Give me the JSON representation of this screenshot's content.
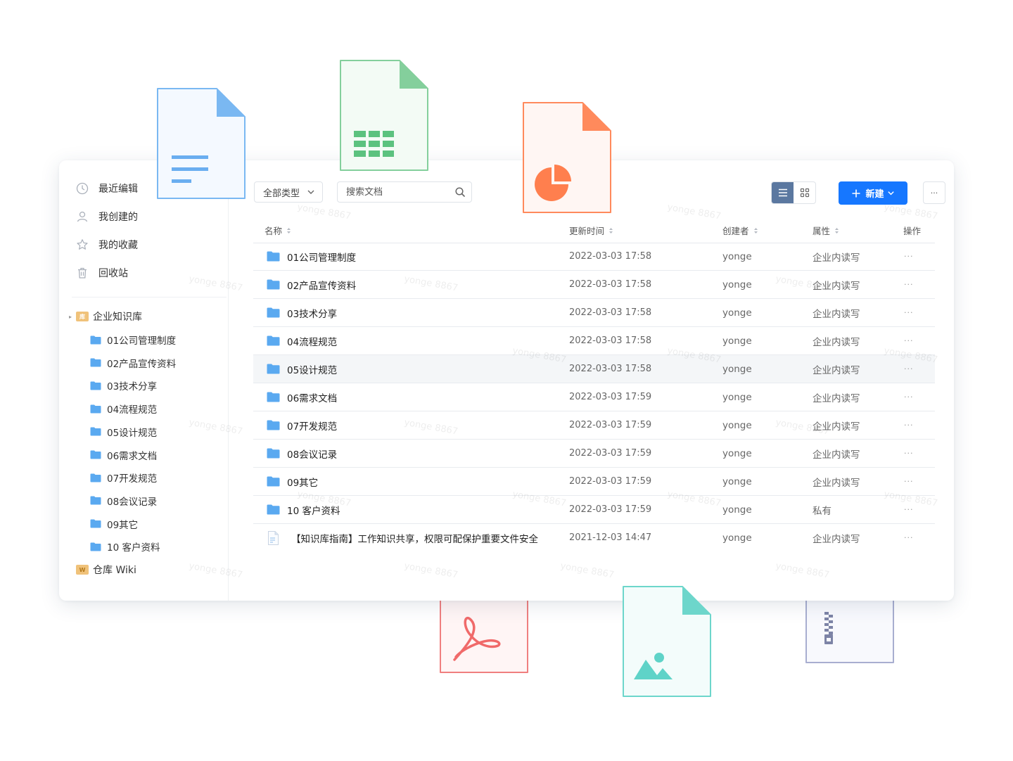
{
  "sidebar": {
    "nav": [
      {
        "label": "最近编辑",
        "icon": "clock-icon"
      },
      {
        "label": "我创建的",
        "icon": "user-icon"
      },
      {
        "label": "我的收藏",
        "icon": "star-icon"
      },
      {
        "label": "回收站",
        "icon": "trash-icon"
      }
    ],
    "tree_root": {
      "label": "企业知识库",
      "badge": "库"
    },
    "tree_children": [
      "01公司管理制度",
      "02产品宣传资料",
      "03技术分享",
      "04流程规范",
      "05设计规范",
      "06需求文档",
      "07开发规范",
      "08会议记录",
      "09其它",
      "10 客户资料"
    ],
    "wiki": {
      "label": "仓库 Wiki",
      "badge": "W"
    }
  },
  "toolbar": {
    "type_filter": "全部类型",
    "search_placeholder": "搜索文档",
    "new_label": "新建",
    "more_label": "···"
  },
  "table": {
    "headers": {
      "name": "名称",
      "time": "更新时间",
      "creator": "创建者",
      "attr": "属性",
      "op": "操作"
    },
    "rows": [
      {
        "name": "01公司管理制度",
        "time": "2022-03-03 17:58",
        "creator": "yonge",
        "attr": "企业内读写",
        "type": "folder"
      },
      {
        "name": "02产品宣传资料",
        "time": "2022-03-03 17:58",
        "creator": "yonge",
        "attr": "企业内读写",
        "type": "folder"
      },
      {
        "name": "03技术分享",
        "time": "2022-03-03 17:58",
        "creator": "yonge",
        "attr": "企业内读写",
        "type": "folder"
      },
      {
        "name": "04流程规范",
        "time": "2022-03-03 17:58",
        "creator": "yonge",
        "attr": "企业内读写",
        "type": "folder"
      },
      {
        "name": "05设计规范",
        "time": "2022-03-03 17:58",
        "creator": "yonge",
        "attr": "企业内读写",
        "type": "folder"
      },
      {
        "name": "06需求文档",
        "time": "2022-03-03 17:59",
        "creator": "yonge",
        "attr": "企业内读写",
        "type": "folder"
      },
      {
        "name": "07开发规范",
        "time": "2022-03-03 17:59",
        "creator": "yonge",
        "attr": "企业内读写",
        "type": "folder"
      },
      {
        "name": "08会议记录",
        "time": "2022-03-03 17:59",
        "creator": "yonge",
        "attr": "企业内读写",
        "type": "folder"
      },
      {
        "name": "09其它",
        "time": "2022-03-03 17:59",
        "creator": "yonge",
        "attr": "企业内读写",
        "type": "folder"
      },
      {
        "name": "10 客户资料",
        "time": "2022-03-03 17:59",
        "creator": "yonge",
        "attr": "私有",
        "type": "folder"
      },
      {
        "name": "【知识库指南】工作知识共享，权限可配保护重要文件安全",
        "time": "2021-12-03 14:47",
        "creator": "yonge",
        "attr": "企业内读写",
        "type": "document"
      }
    ],
    "op_label": "···"
  },
  "watermark": "yonge 8867",
  "colors": {
    "primary": "#1677ff",
    "folder": "#5aa9f0",
    "doc": "#6aaef0",
    "sheet": "#5cc27f",
    "slides": "#ff7f4e",
    "pdf": "#f06a6a",
    "image": "#5fd3c8",
    "zip": "#9fa6c7"
  },
  "floating_icons": [
    "document-file-icon",
    "spreadsheet-file-icon",
    "presentation-file-icon",
    "pdf-file-icon",
    "image-file-icon",
    "zip-file-icon"
  ]
}
